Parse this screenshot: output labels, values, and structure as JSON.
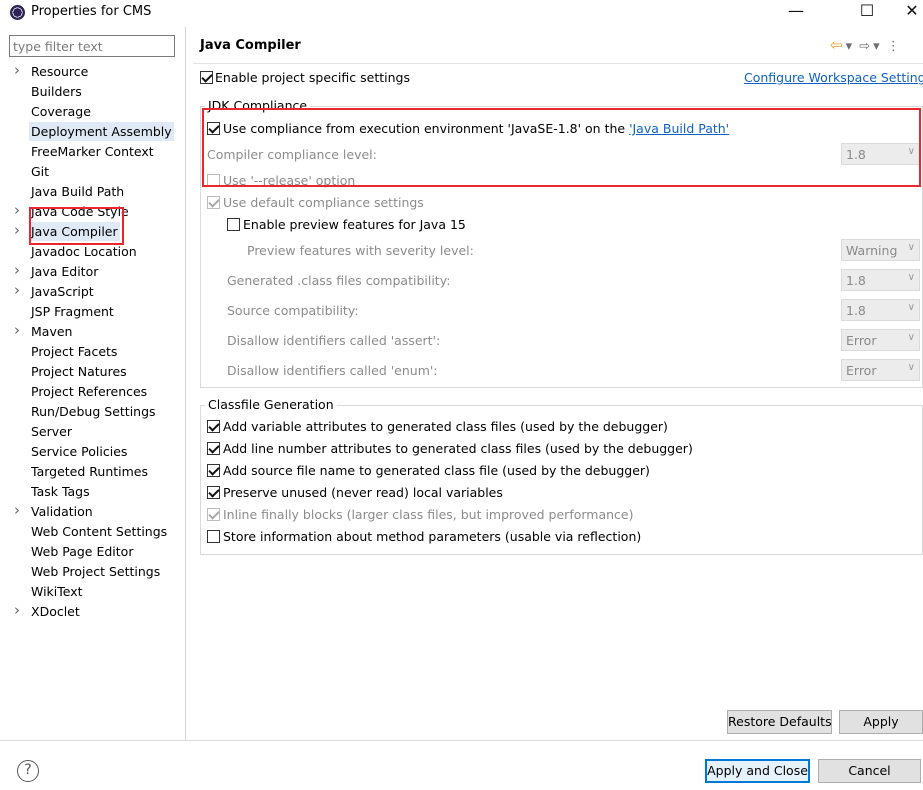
{
  "window": {
    "title": "Properties for CMS",
    "minimize": "—",
    "maximize": "☐",
    "close": "✕"
  },
  "filter": {
    "placeholder": "type filter text"
  },
  "tree": [
    {
      "label": "Resource",
      "expandable": true
    },
    {
      "label": "Builders",
      "expandable": false
    },
    {
      "label": "Coverage",
      "expandable": false
    },
    {
      "label": "Deployment Assembly",
      "expandable": false,
      "highlight": true
    },
    {
      "label": "FreeMarker Context",
      "expandable": false
    },
    {
      "label": "Git",
      "expandable": false
    },
    {
      "label": "Java Build Path",
      "expandable": false
    },
    {
      "label": "Java Code Style",
      "expandable": true
    },
    {
      "label": "Java Compiler",
      "expandable": true,
      "highlight": true
    },
    {
      "label": "Javadoc Location",
      "expandable": false
    },
    {
      "label": "Java Editor",
      "expandable": true
    },
    {
      "label": "JavaScript",
      "expandable": true
    },
    {
      "label": "JSP Fragment",
      "expandable": false
    },
    {
      "label": "Maven",
      "expandable": true
    },
    {
      "label": "Project Facets",
      "expandable": false
    },
    {
      "label": "Project Natures",
      "expandable": false
    },
    {
      "label": "Project References",
      "expandable": false
    },
    {
      "label": "Run/Debug Settings",
      "expandable": false
    },
    {
      "label": "Server",
      "expandable": false
    },
    {
      "label": "Service Policies",
      "expandable": false
    },
    {
      "label": "Targeted Runtimes",
      "expandable": false
    },
    {
      "label": "Task Tags",
      "expandable": false
    },
    {
      "label": "Validation",
      "expandable": true
    },
    {
      "label": "Web Content Settings",
      "expandable": false
    },
    {
      "label": "Web Page Editor",
      "expandable": false
    },
    {
      "label": "Web Project Settings",
      "expandable": false
    },
    {
      "label": "WikiText",
      "expandable": false
    },
    {
      "label": "XDoclet",
      "expandable": true
    }
  ],
  "page": {
    "title": "Java Compiler",
    "enable_project_specific": {
      "label": "Enable project specific settings",
      "checked": true
    },
    "configure_workspace_link": "Configure Workspace Settings...",
    "jdk": {
      "group_title": "JDK Compliance",
      "use_compliance": {
        "label": "Use compliance from execution environment 'JavaSE-1.8' on the ",
        "link": "'Java Build Path'",
        "checked": true
      },
      "compliance_level": {
        "label": "Compiler compliance level:",
        "value": "1.8"
      },
      "use_release": {
        "label": "Use '--release' option",
        "checked": false
      },
      "use_default": {
        "label": "Use default compliance settings",
        "checked": true
      },
      "enable_preview": {
        "label": "Enable preview features for Java 15",
        "checked": false
      },
      "preview_severity": {
        "label": "Preview features with severity level:",
        "value": "Warning"
      },
      "generated_compat": {
        "label": "Generated .class files compatibility:",
        "value": "1.8"
      },
      "source_compat": {
        "label": "Source compatibility:",
        "value": "1.8"
      },
      "disallow_assert": {
        "label": "Disallow identifiers called 'assert':",
        "value": "Error"
      },
      "disallow_enum": {
        "label": "Disallow identifiers called 'enum':",
        "value": "Error"
      }
    },
    "classfile": {
      "group_title": "Classfile Generation",
      "items": [
        {
          "label": "Add variable attributes to generated class files (used by the debugger)",
          "checked": true,
          "disabled": false
        },
        {
          "label": "Add line number attributes to generated class files (used by the debugger)",
          "checked": true,
          "disabled": false
        },
        {
          "label": "Add source file name to generated class file (used by the debugger)",
          "checked": true,
          "disabled": false
        },
        {
          "label": "Preserve unused (never read) local variables",
          "checked": true,
          "disabled": false
        },
        {
          "label": "Inline finally blocks (larger class files, but improved performance)",
          "checked": true,
          "disabled": true
        },
        {
          "label": "Store information about method parameters (usable via reflection)",
          "checked": false,
          "disabled": false
        }
      ]
    },
    "restore_defaults": "Restore Defaults",
    "apply": "Apply"
  },
  "footer": {
    "help": "?",
    "apply_close": "Apply and Close",
    "cancel": "Cancel"
  },
  "colors": {
    "annotation": "#e8282c",
    "link": "#0f62c4",
    "selection": "#e0eaf7"
  }
}
